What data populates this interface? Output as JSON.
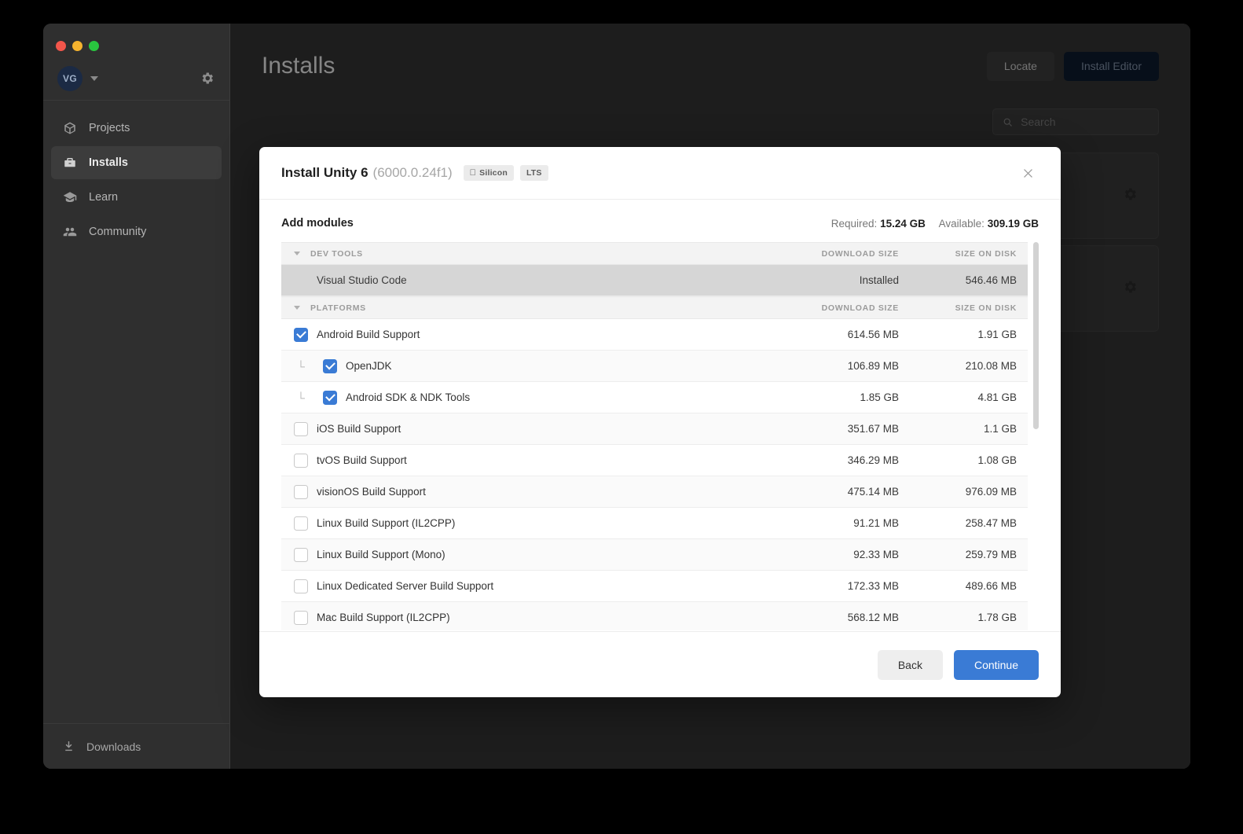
{
  "window": {
    "traffic_lights": [
      "close",
      "minimize",
      "zoom"
    ]
  },
  "sidebar": {
    "account": {
      "initials": "VG"
    },
    "gear_icon": "gear-icon",
    "items": [
      {
        "label": "Projects",
        "icon": "cube-icon",
        "active": false
      },
      {
        "label": "Installs",
        "icon": "toolbox-icon",
        "active": true
      },
      {
        "label": "Learn",
        "icon": "graduation-cap-icon",
        "active": false
      },
      {
        "label": "Community",
        "icon": "people-icon",
        "active": false
      }
    ],
    "downloads": {
      "label": "Downloads",
      "icon": "download-icon"
    }
  },
  "header": {
    "title": "Installs",
    "locate_label": "Locate",
    "install_editor_label": "Install Editor"
  },
  "search": {
    "placeholder": "Search",
    "value": ""
  },
  "modal": {
    "title": "Install Unity 6",
    "version": "(6000.0.24f1)",
    "badges": [
      {
        "label": "Silicon",
        "icon": "apple-icon"
      },
      {
        "label": "LTS",
        "icon": ""
      }
    ],
    "close_icon": "close-icon",
    "add_modules_label": "Add modules",
    "required_label": "Required:",
    "required_value": "15.24 GB",
    "available_label": "Available:",
    "available_value": "309.19 GB",
    "columns": {
      "download_size": "DOWNLOAD SIZE",
      "size_on_disk": "SIZE ON DISK"
    },
    "groups": [
      {
        "name": "DEV TOOLS",
        "expanded": true,
        "rows": [
          {
            "label": "Visual Studio Code",
            "state": "installed",
            "checkbox": "none",
            "download_size": "Installed",
            "size_on_disk": "546.46 MB",
            "child": false
          }
        ]
      },
      {
        "name": "PLATFORMS",
        "expanded": true,
        "rows": [
          {
            "label": "Android Build Support",
            "state": "normal",
            "checkbox": "checked",
            "download_size": "614.56 MB",
            "size_on_disk": "1.91 GB",
            "child": false
          },
          {
            "label": "OpenJDK",
            "state": "normal",
            "checkbox": "checked",
            "download_size": "106.89 MB",
            "size_on_disk": "210.08 MB",
            "child": true
          },
          {
            "label": "Android SDK & NDK Tools",
            "state": "normal",
            "checkbox": "checked",
            "download_size": "1.85 GB",
            "size_on_disk": "4.81 GB",
            "child": true
          },
          {
            "label": "iOS Build Support",
            "state": "normal",
            "checkbox": "unchecked",
            "download_size": "351.67 MB",
            "size_on_disk": "1.1 GB",
            "child": false
          },
          {
            "label": "tvOS Build Support",
            "state": "normal",
            "checkbox": "unchecked",
            "download_size": "346.29 MB",
            "size_on_disk": "1.08 GB",
            "child": false
          },
          {
            "label": "visionOS Build Support",
            "state": "normal",
            "checkbox": "unchecked",
            "download_size": "475.14 MB",
            "size_on_disk": "976.09 MB",
            "child": false
          },
          {
            "label": "Linux Build Support (IL2CPP)",
            "state": "normal",
            "checkbox": "unchecked",
            "download_size": "91.21 MB",
            "size_on_disk": "258.47 MB",
            "child": false
          },
          {
            "label": "Linux Build Support (Mono)",
            "state": "normal",
            "checkbox": "unchecked",
            "download_size": "92.33 MB",
            "size_on_disk": "259.79 MB",
            "child": false
          },
          {
            "label": "Linux Dedicated Server Build Support",
            "state": "normal",
            "checkbox": "unchecked",
            "download_size": "172.33 MB",
            "size_on_disk": "489.66 MB",
            "child": false
          },
          {
            "label": "Mac Build Support (IL2CPP)",
            "state": "normal",
            "checkbox": "unchecked",
            "download_size": "568.12 MB",
            "size_on_disk": "1.78 GB",
            "child": false
          }
        ]
      }
    ],
    "back_label": "Back",
    "continue_label": "Continue"
  },
  "colors": {
    "accent": "#3a7bd5",
    "app_bg": "#323232",
    "modal_bg": "#ffffff",
    "installed_row": "#d6d6d6"
  }
}
